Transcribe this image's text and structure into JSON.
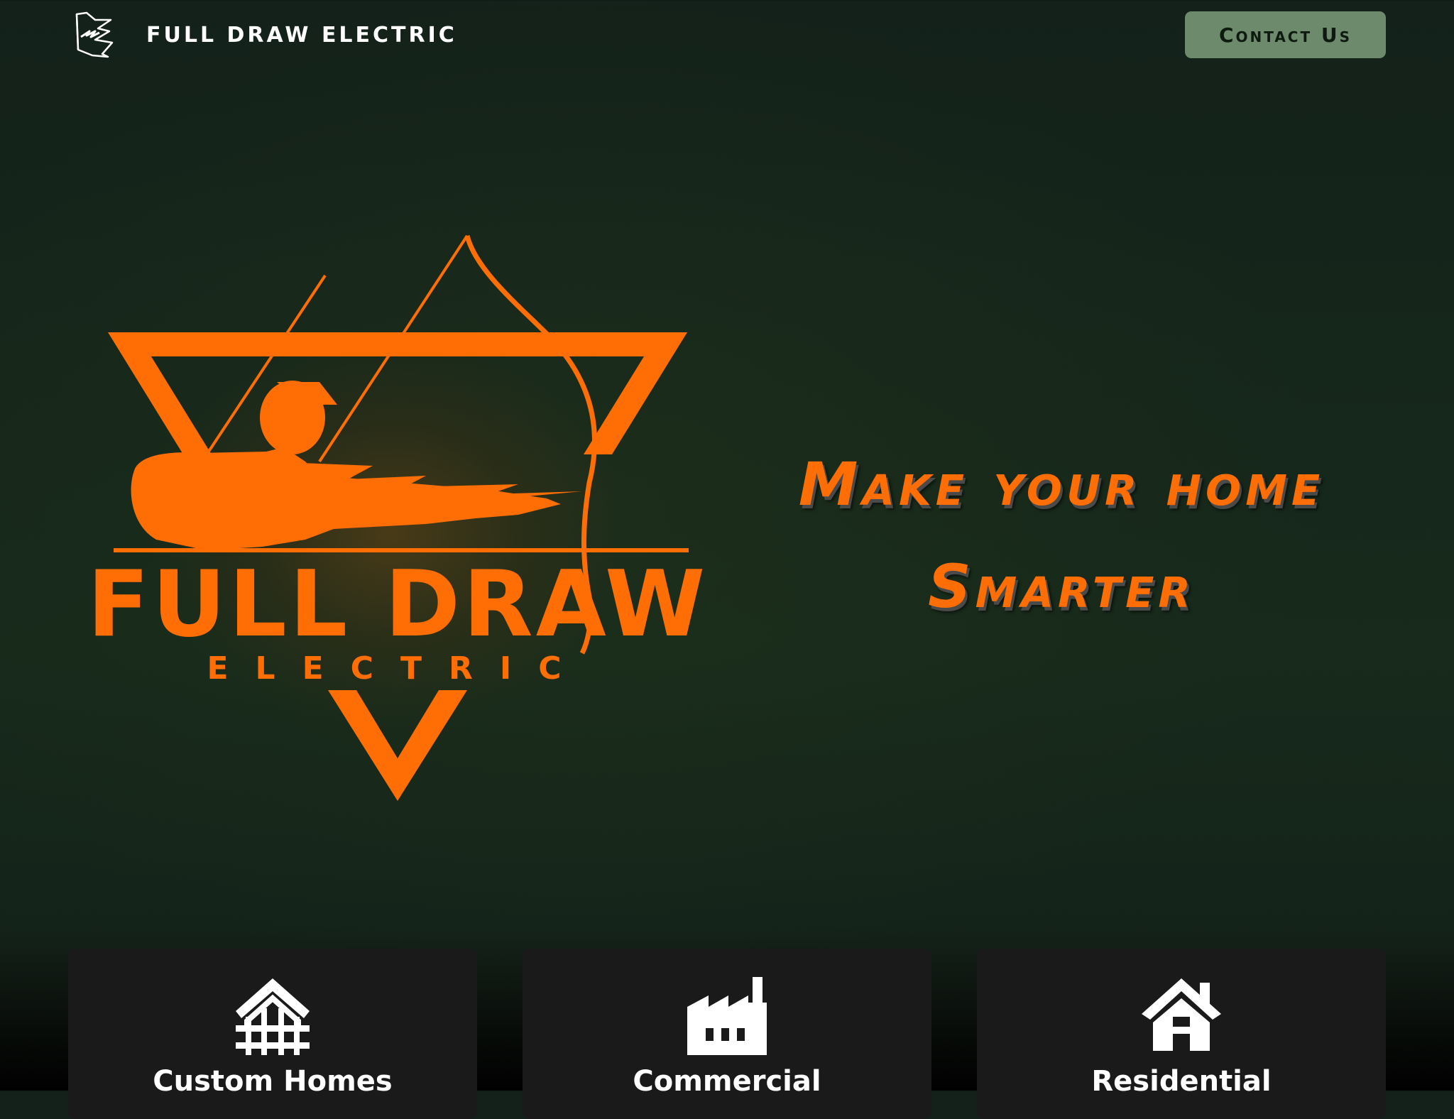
{
  "header": {
    "brand_name": "FULL DRAW ELECTRIC",
    "brand_icon": "archer-bolt-icon",
    "contact_label": "Contact Us"
  },
  "hero": {
    "logo": {
      "line1": "FULL DRAW",
      "line2": "ELECTRIC",
      "icon": "archer-triangle-logo"
    },
    "tagline_line1": "Make your home",
    "tagline_line2": "Smarter"
  },
  "services": [
    {
      "title": "Custom Homes",
      "icon": "home-frame-icon"
    },
    {
      "title": "Commercial",
      "icon": "factory-icon"
    },
    {
      "title": "Residential",
      "icon": "house-icon"
    }
  ],
  "colors": {
    "accent": "#ff6d05",
    "background": "#172a1b",
    "button": "#6e8a6c",
    "card": "#1a1a1a",
    "text": "#ffffff"
  }
}
